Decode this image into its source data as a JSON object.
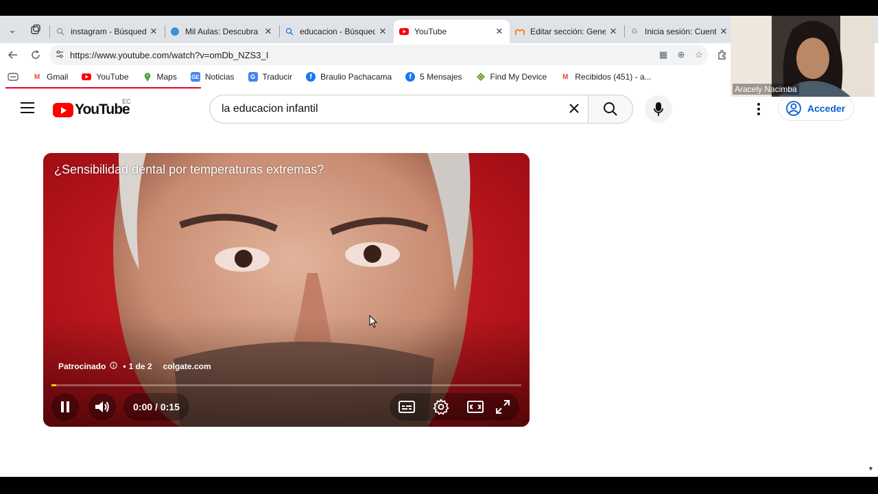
{
  "tabs": [
    {
      "title": "instagram - Búsqueda",
      "icon": "search-icon"
    },
    {
      "title": "Mil Aulas: Descubra Mo",
      "icon": "globe-icon"
    },
    {
      "title": "educacion - Búsqueda",
      "icon": "search-icon"
    },
    {
      "title": "YouTube",
      "icon": "youtube-icon",
      "active": true
    },
    {
      "title": "Editar sección: General",
      "icon": "moodle-icon"
    },
    {
      "title": "Inicia sesión: Cuentas d",
      "icon": "google-icon"
    }
  ],
  "address": {
    "url": "https://www.youtube.com/watch?v=omDb_NZS3_I"
  },
  "bookmarks": [
    {
      "label": "Gmail",
      "icon": "gmail-icon"
    },
    {
      "label": "YouTube",
      "icon": "youtube-icon"
    },
    {
      "label": "Maps",
      "icon": "maps-icon"
    },
    {
      "label": "Noticias",
      "icon": "news-icon"
    },
    {
      "label": "Traducir",
      "icon": "translate-icon"
    },
    {
      "label": "Braulio Pachacama",
      "icon": "facebook-icon"
    },
    {
      "label": "5 Mensajes",
      "icon": "facebook-icon"
    },
    {
      "label": "Find My Device",
      "icon": "find-device-icon"
    },
    {
      "label": "Recibidos (451) - a...",
      "icon": "gmail-icon"
    }
  ],
  "youtube": {
    "logo_text": "YouTube",
    "country_code": "EC",
    "search_query": "la educacion infantil",
    "signin_label": "Acceder"
  },
  "player": {
    "ad_title": "¿Sensibilidad dental por temperaturas extremas?",
    "sponsored_label": "Patrocinado",
    "ad_count": "1 de 2",
    "advertiser": "colgate.com",
    "current_time": "0:00",
    "duration": "0:15",
    "time_display": "0:00 / 0:15",
    "progress_fraction": 0.01
  },
  "webcam": {
    "participant_name": "Aracely Nacimba"
  },
  "colors": {
    "youtube_red": "#ff0000",
    "link_blue": "#065fd4",
    "ad_progress": "#ffcc00"
  }
}
